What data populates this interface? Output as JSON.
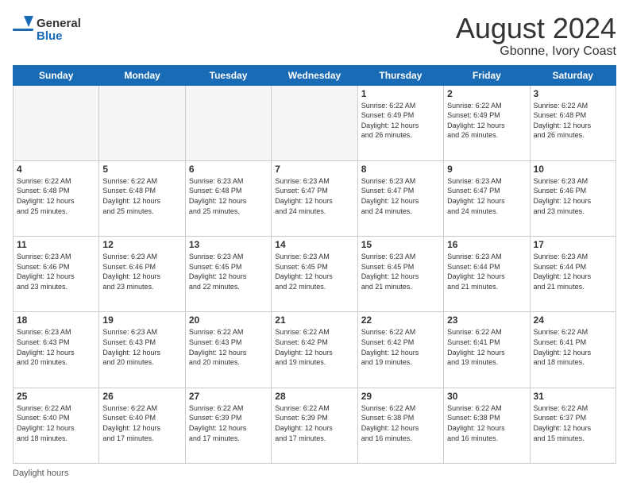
{
  "header": {
    "logo_general": "General",
    "logo_blue": "Blue",
    "month_title": "August 2024",
    "location": "Gbonne, Ivory Coast"
  },
  "days_of_week": [
    "Sunday",
    "Monday",
    "Tuesday",
    "Wednesday",
    "Thursday",
    "Friday",
    "Saturday"
  ],
  "weeks": [
    [
      {
        "day": "",
        "info": ""
      },
      {
        "day": "",
        "info": ""
      },
      {
        "day": "",
        "info": ""
      },
      {
        "day": "",
        "info": ""
      },
      {
        "day": "1",
        "info": "Sunrise: 6:22 AM\nSunset: 6:49 PM\nDaylight: 12 hours\nand 26 minutes."
      },
      {
        "day": "2",
        "info": "Sunrise: 6:22 AM\nSunset: 6:49 PM\nDaylight: 12 hours\nand 26 minutes."
      },
      {
        "day": "3",
        "info": "Sunrise: 6:22 AM\nSunset: 6:48 PM\nDaylight: 12 hours\nand 26 minutes."
      }
    ],
    [
      {
        "day": "4",
        "info": "Sunrise: 6:22 AM\nSunset: 6:48 PM\nDaylight: 12 hours\nand 25 minutes."
      },
      {
        "day": "5",
        "info": "Sunrise: 6:22 AM\nSunset: 6:48 PM\nDaylight: 12 hours\nand 25 minutes."
      },
      {
        "day": "6",
        "info": "Sunrise: 6:23 AM\nSunset: 6:48 PM\nDaylight: 12 hours\nand 25 minutes."
      },
      {
        "day": "7",
        "info": "Sunrise: 6:23 AM\nSunset: 6:47 PM\nDaylight: 12 hours\nand 24 minutes."
      },
      {
        "day": "8",
        "info": "Sunrise: 6:23 AM\nSunset: 6:47 PM\nDaylight: 12 hours\nand 24 minutes."
      },
      {
        "day": "9",
        "info": "Sunrise: 6:23 AM\nSunset: 6:47 PM\nDaylight: 12 hours\nand 24 minutes."
      },
      {
        "day": "10",
        "info": "Sunrise: 6:23 AM\nSunset: 6:46 PM\nDaylight: 12 hours\nand 23 minutes."
      }
    ],
    [
      {
        "day": "11",
        "info": "Sunrise: 6:23 AM\nSunset: 6:46 PM\nDaylight: 12 hours\nand 23 minutes."
      },
      {
        "day": "12",
        "info": "Sunrise: 6:23 AM\nSunset: 6:46 PM\nDaylight: 12 hours\nand 23 minutes."
      },
      {
        "day": "13",
        "info": "Sunrise: 6:23 AM\nSunset: 6:45 PM\nDaylight: 12 hours\nand 22 minutes."
      },
      {
        "day": "14",
        "info": "Sunrise: 6:23 AM\nSunset: 6:45 PM\nDaylight: 12 hours\nand 22 minutes."
      },
      {
        "day": "15",
        "info": "Sunrise: 6:23 AM\nSunset: 6:45 PM\nDaylight: 12 hours\nand 21 minutes."
      },
      {
        "day": "16",
        "info": "Sunrise: 6:23 AM\nSunset: 6:44 PM\nDaylight: 12 hours\nand 21 minutes."
      },
      {
        "day": "17",
        "info": "Sunrise: 6:23 AM\nSunset: 6:44 PM\nDaylight: 12 hours\nand 21 minutes."
      }
    ],
    [
      {
        "day": "18",
        "info": "Sunrise: 6:23 AM\nSunset: 6:43 PM\nDaylight: 12 hours\nand 20 minutes."
      },
      {
        "day": "19",
        "info": "Sunrise: 6:23 AM\nSunset: 6:43 PM\nDaylight: 12 hours\nand 20 minutes."
      },
      {
        "day": "20",
        "info": "Sunrise: 6:22 AM\nSunset: 6:43 PM\nDaylight: 12 hours\nand 20 minutes."
      },
      {
        "day": "21",
        "info": "Sunrise: 6:22 AM\nSunset: 6:42 PM\nDaylight: 12 hours\nand 19 minutes."
      },
      {
        "day": "22",
        "info": "Sunrise: 6:22 AM\nSunset: 6:42 PM\nDaylight: 12 hours\nand 19 minutes."
      },
      {
        "day": "23",
        "info": "Sunrise: 6:22 AM\nSunset: 6:41 PM\nDaylight: 12 hours\nand 19 minutes."
      },
      {
        "day": "24",
        "info": "Sunrise: 6:22 AM\nSunset: 6:41 PM\nDaylight: 12 hours\nand 18 minutes."
      }
    ],
    [
      {
        "day": "25",
        "info": "Sunrise: 6:22 AM\nSunset: 6:40 PM\nDaylight: 12 hours\nand 18 minutes."
      },
      {
        "day": "26",
        "info": "Sunrise: 6:22 AM\nSunset: 6:40 PM\nDaylight: 12 hours\nand 17 minutes."
      },
      {
        "day": "27",
        "info": "Sunrise: 6:22 AM\nSunset: 6:39 PM\nDaylight: 12 hours\nand 17 minutes."
      },
      {
        "day": "28",
        "info": "Sunrise: 6:22 AM\nSunset: 6:39 PM\nDaylight: 12 hours\nand 17 minutes."
      },
      {
        "day": "29",
        "info": "Sunrise: 6:22 AM\nSunset: 6:38 PM\nDaylight: 12 hours\nand 16 minutes."
      },
      {
        "day": "30",
        "info": "Sunrise: 6:22 AM\nSunset: 6:38 PM\nDaylight: 12 hours\nand 16 minutes."
      },
      {
        "day": "31",
        "info": "Sunrise: 6:22 AM\nSunset: 6:37 PM\nDaylight: 12 hours\nand 15 minutes."
      }
    ]
  ],
  "footer": {
    "daylight_label": "Daylight hours"
  }
}
